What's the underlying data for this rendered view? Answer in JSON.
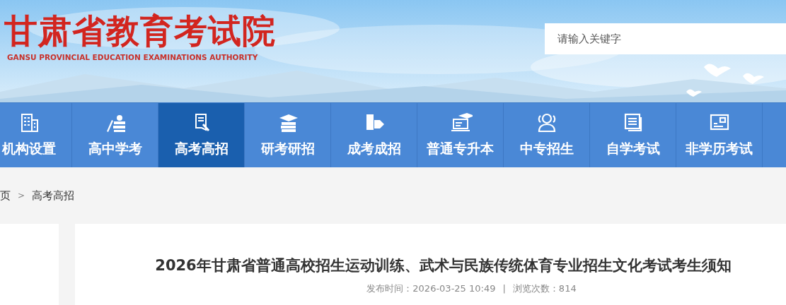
{
  "header": {
    "title": "甘肃省教育考试院",
    "subtitle": "GANSU PROVINCIAL EDUCATION EXAMINATIONS AUTHORITY",
    "search": {
      "placeholder": "请输入关键字"
    }
  },
  "nav": [
    {
      "label": "机构设置",
      "selected": false
    },
    {
      "label": "高中学考",
      "selected": false
    },
    {
      "label": "高考高招",
      "selected": true
    },
    {
      "label": "研考研招",
      "selected": false
    },
    {
      "label": "成考成招",
      "selected": false
    },
    {
      "label": "普通专升本",
      "selected": false
    },
    {
      "label": "中专招生",
      "selected": false
    },
    {
      "label": "自学考试",
      "selected": false
    },
    {
      "label": "非学历考试",
      "selected": false
    }
  ],
  "breadcrumb": [
    "页",
    "高考高招"
  ],
  "breadcrumb_separator": ">",
  "article": {
    "title": "2026年甘肃省普通高校招生运动训练、武术与民族传统体育专业招生文化考试考生须知",
    "published": "发布时间：2026-03-25 10:49",
    "separator": "|",
    "views": "浏览次数：814"
  }
}
